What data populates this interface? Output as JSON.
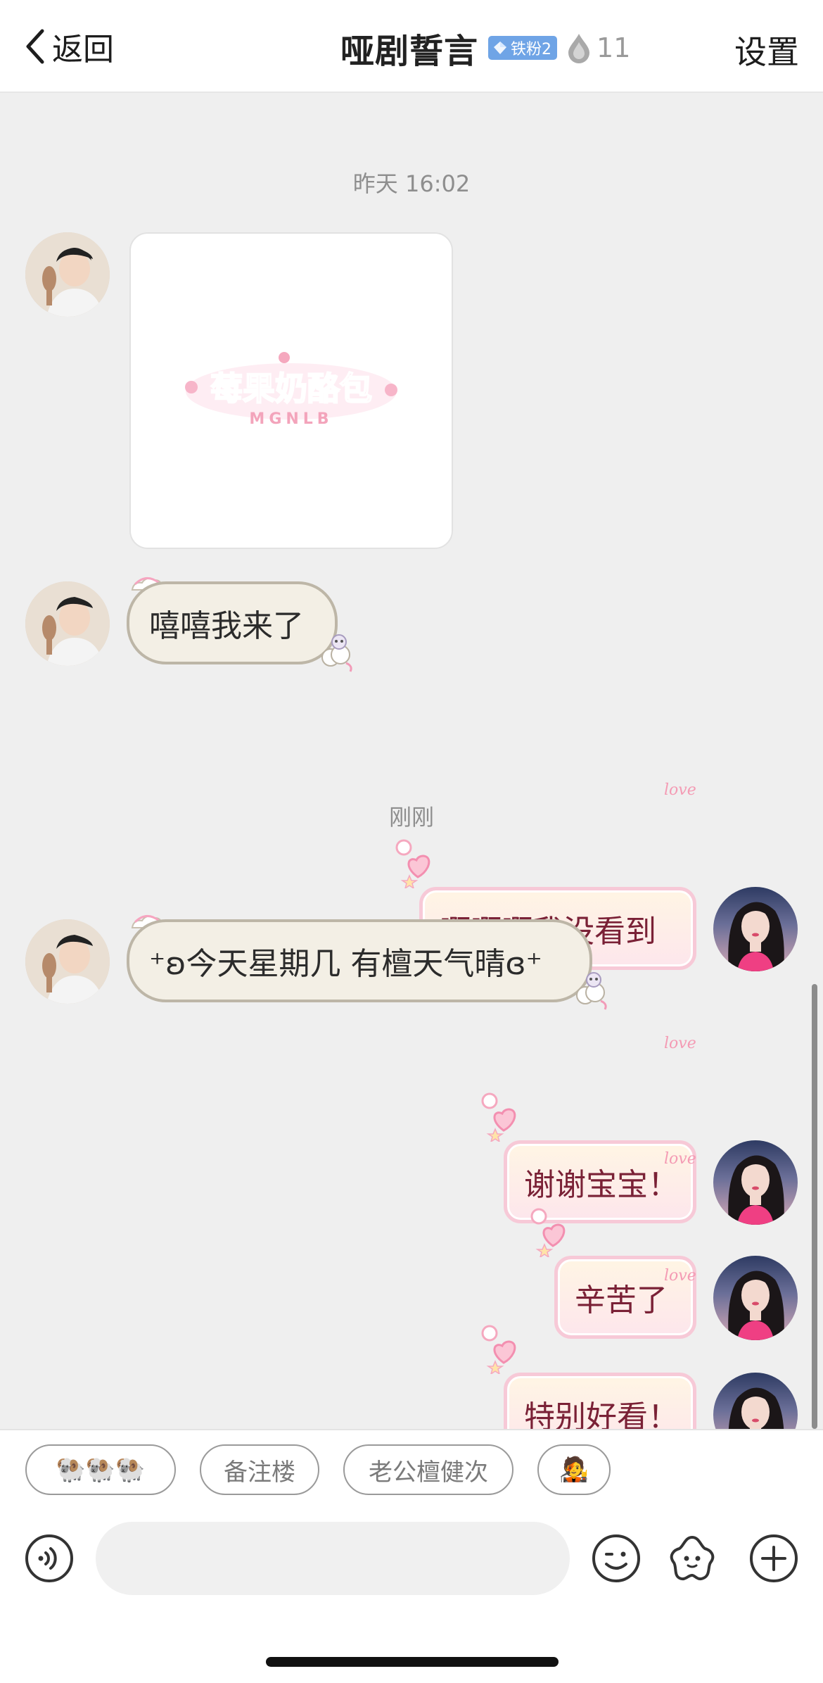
{
  "header": {
    "back_label": "返回",
    "title": "哑剧誓言",
    "fan_badge": "铁粉2",
    "fan_count": "11",
    "settings_label": "设置"
  },
  "chat": {
    "timestamps": [
      "昨天 16:02",
      "刚刚"
    ],
    "image_sticker": {
      "main_text": "莓果奶酪包",
      "sub_text": "MGNLB"
    },
    "messages": [
      {
        "side": "left",
        "text": "嘻嘻我来了"
      },
      {
        "side": "right",
        "text": "啊啊啊我没看到"
      },
      {
        "side": "left",
        "text": "⁺ʚ今天星期几 有檀天气晴ɞ⁺"
      },
      {
        "side": "right",
        "text": "谢谢宝宝！"
      },
      {
        "side": "right",
        "text": "辛苦了"
      },
      {
        "side": "right",
        "text": "特别好看！"
      }
    ],
    "decoration_word": "love"
  },
  "quick_replies": [
    {
      "label": "🐏🐏🐏"
    },
    {
      "label": "备注楼"
    },
    {
      "label": "老公檀健次"
    },
    {
      "label": "🧑‍🎤"
    }
  ],
  "input_bar": {
    "placeholder": "",
    "icons": [
      "voice-icon",
      "emoji-icon",
      "sticker-flower-icon",
      "plus-icon"
    ]
  },
  "colors": {
    "bubble_left_bg": "#f3efe5",
    "bubble_right_border": "#f7c9d7",
    "badge_blue": "#6fa4e6"
  }
}
